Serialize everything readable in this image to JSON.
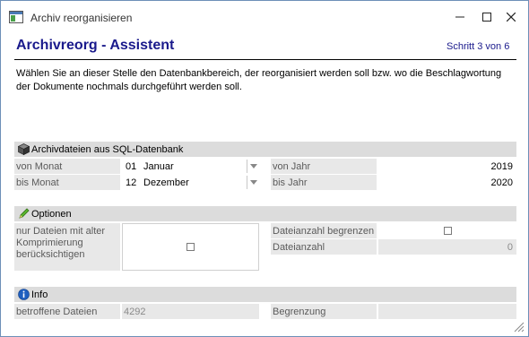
{
  "window": {
    "title": "Archiv reorganisieren",
    "minimize_icon": "minimize-icon",
    "maximize_icon": "maximize-icon",
    "close_icon": "close-icon"
  },
  "header": {
    "title": "Archivreorg - Assistent",
    "step": "Schritt 3 von 6",
    "description": "Wählen Sie an dieser Stelle den Datenbankbereich, der reorganisiert werden soll bzw. wo die Beschlagwortung der Dokumente nochmals durchgeführt werden soll."
  },
  "section_archive": {
    "title": "Archivdateien aus SQL-Datenbank",
    "icon": "database-icon",
    "von_monat_label": "von Monat",
    "von_monat_num": "01",
    "von_monat_name": "Januar",
    "bis_monat_label": "bis Monat",
    "bis_monat_num": "12",
    "bis_monat_name": "Dezember",
    "von_jahr_label": "von Jahr",
    "von_jahr_value": "2019",
    "bis_jahr_label": "bis Jahr",
    "bis_jahr_value": "2020"
  },
  "section_options": {
    "title": "Optionen",
    "icon": "pencil-icon",
    "alter_kompr_label": "nur Dateien mit alter Komprimierung berücksichtigen",
    "alter_kompr_checked": false,
    "dateianzahl_begrenzen_label": "Dateianzahl begrenzen",
    "dateianzahl_begrenzen_checked": false,
    "dateianzahl_label": "Dateianzahl",
    "dateianzahl_value": "0"
  },
  "section_info": {
    "title": "Info",
    "icon": "info-icon",
    "betroffene_label": "betroffene Dateien",
    "betroffene_value": "4292",
    "begrenzung_label": "Begrenzung",
    "begrenzung_value": ""
  },
  "colors": {
    "header_title": "#1a1a8c",
    "section_bg": "#dcdcdc",
    "label_bg": "#e8e8e8",
    "window_border": "#6d8fb8"
  }
}
